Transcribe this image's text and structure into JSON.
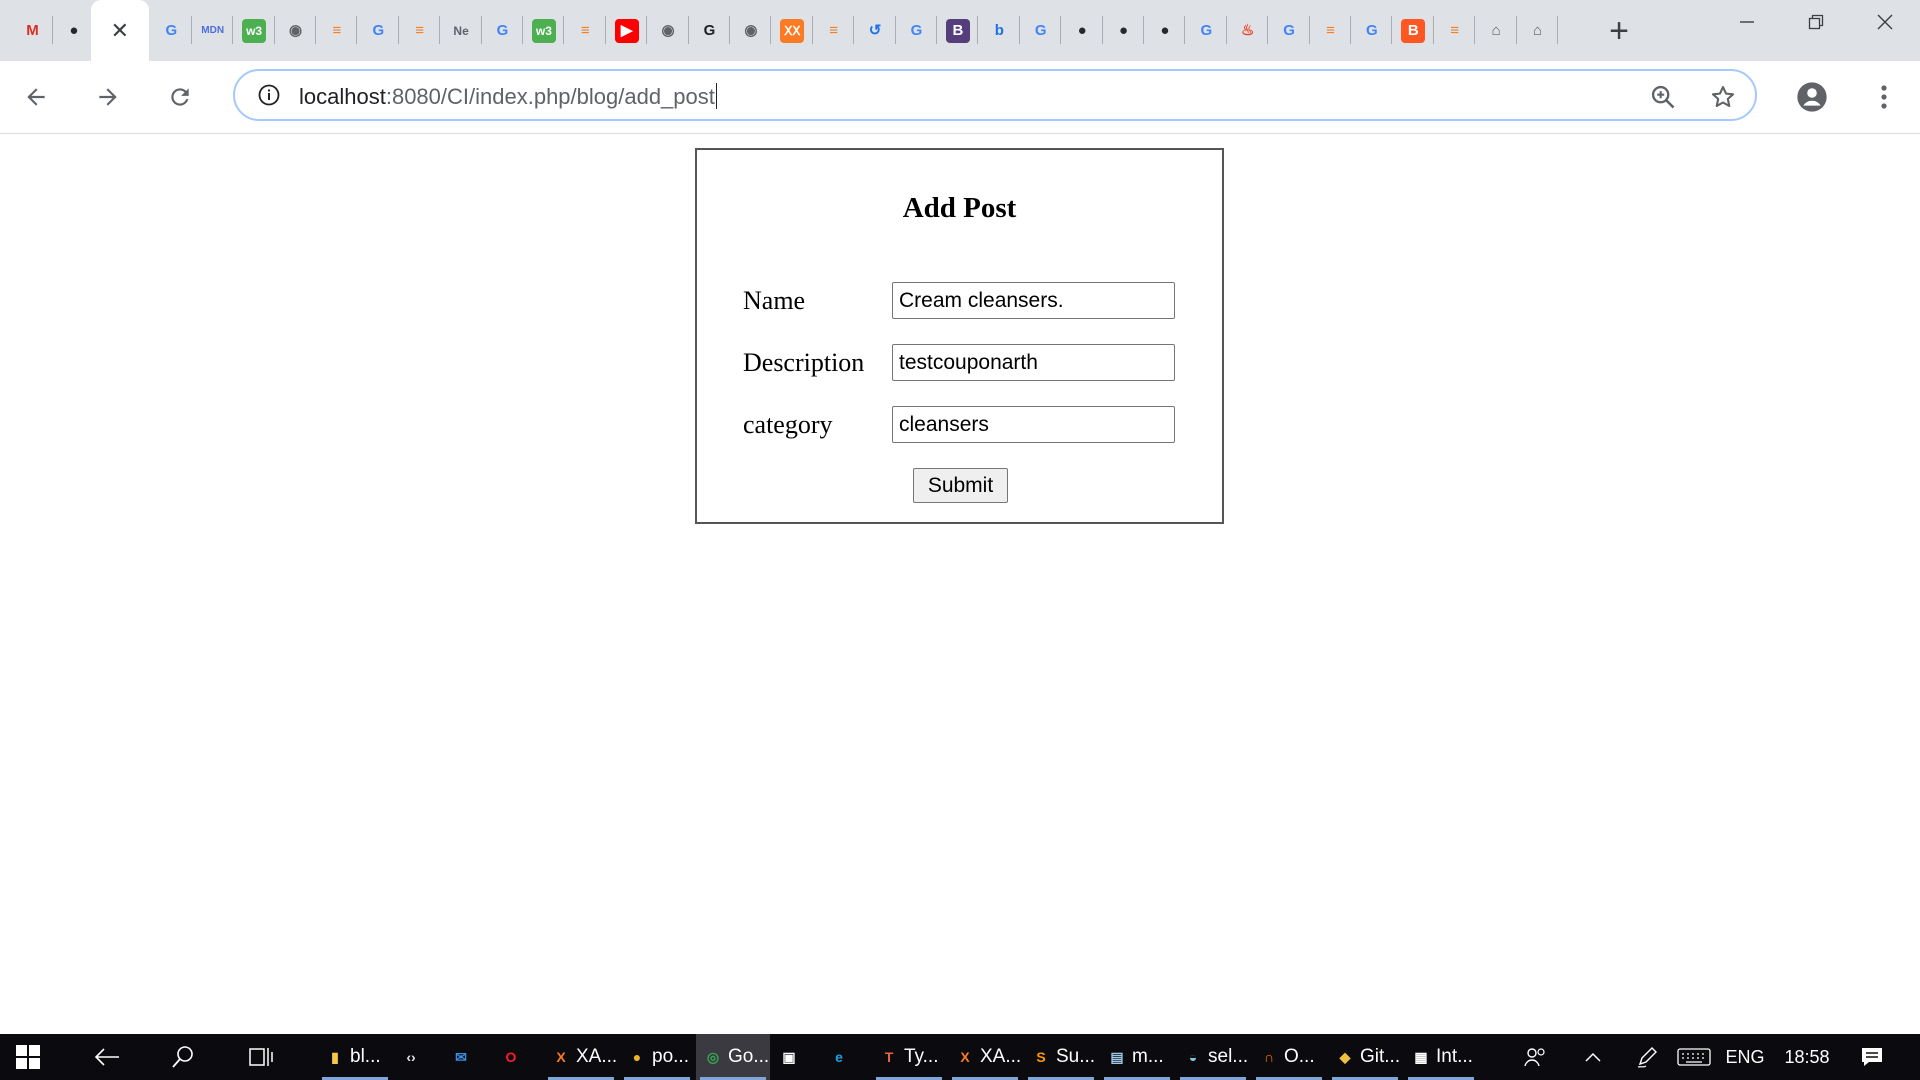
{
  "browser": {
    "tabs": [
      {
        "icon": "gmail-icon",
        "glyph": "M",
        "color": "#d93025",
        "bg": "transparent"
      },
      {
        "icon": "github-icon",
        "glyph": "●",
        "color": "#24292e",
        "bg": "transparent"
      },
      {
        "icon": "close-tab-icon",
        "glyph": "✕",
        "color": "#3c4043",
        "bg": "transparent",
        "active": true
      },
      {
        "icon": "google-icon",
        "glyph": "G",
        "color": "#4285f4",
        "bg": "transparent"
      },
      {
        "icon": "mdn-icon",
        "glyph": "MDN",
        "color": "#4a6ee0",
        "bg": "transparent"
      },
      {
        "icon": "w3schools-icon",
        "glyph": "w3",
        "color": "#ffffff",
        "bg": "#4caf50"
      },
      {
        "icon": "globe-icon",
        "glyph": "◉",
        "color": "#5f6368",
        "bg": "transparent"
      },
      {
        "icon": "stackoverflow-icon",
        "glyph": "≡",
        "color": "#f48024",
        "bg": "transparent"
      },
      {
        "icon": "google-icon",
        "glyph": "G",
        "color": "#4285f4",
        "bg": "transparent"
      },
      {
        "icon": "stackoverflow-icon",
        "glyph": "≡",
        "color": "#f48024",
        "bg": "transparent"
      },
      {
        "icon": "ne-icon",
        "glyph": "Ne",
        "color": "#5f6368",
        "bg": "transparent"
      },
      {
        "icon": "google-icon",
        "glyph": "G",
        "color": "#4285f4",
        "bg": "transparent"
      },
      {
        "icon": "w3schools-icon",
        "glyph": "w3",
        "color": "#ffffff",
        "bg": "#4caf50"
      },
      {
        "icon": "stackoverflow-icon",
        "glyph": "≡",
        "color": "#f48024",
        "bg": "transparent"
      },
      {
        "icon": "youtube-icon",
        "glyph": "▶",
        "color": "#ffffff",
        "bg": "#ff0000"
      },
      {
        "icon": "globe-icon",
        "glyph": "◉",
        "color": "#5f6368",
        "bg": "transparent"
      },
      {
        "icon": "grammarly-icon",
        "glyph": "G",
        "color": "#202124",
        "bg": "transparent"
      },
      {
        "icon": "globe-icon",
        "glyph": "◉",
        "color": "#5f6368",
        "bg": "transparent"
      },
      {
        "icon": "xampp-icon",
        "glyph": "ⅩⅩ",
        "color": "#ffffff",
        "bg": "#fb7a24"
      },
      {
        "icon": "stackoverflow-icon",
        "glyph": "≡",
        "color": "#f48024",
        "bg": "transparent"
      },
      {
        "icon": "history-icon",
        "glyph": "↺",
        "color": "#1a73e8",
        "bg": "transparent"
      },
      {
        "icon": "google-icon",
        "glyph": "G",
        "color": "#4285f4",
        "bg": "transparent"
      },
      {
        "icon": "bootstrap-icon",
        "glyph": "B",
        "color": "#ffffff",
        "bg": "#563d7c"
      },
      {
        "icon": "bing-icon",
        "glyph": "b",
        "color": "#1a73e8",
        "bg": "transparent"
      },
      {
        "icon": "google-icon",
        "glyph": "G",
        "color": "#4285f4",
        "bg": "transparent"
      },
      {
        "icon": "github-icon",
        "glyph": "●",
        "color": "#24292e",
        "bg": "transparent"
      },
      {
        "icon": "github-icon",
        "glyph": "●",
        "color": "#24292e",
        "bg": "transparent"
      },
      {
        "icon": "github-icon",
        "glyph": "●",
        "color": "#24292e",
        "bg": "transparent"
      },
      {
        "icon": "google-icon",
        "glyph": "G",
        "color": "#4285f4",
        "bg": "transparent"
      },
      {
        "icon": "codeigniter-icon",
        "glyph": "♨",
        "color": "#ee4323",
        "bg": "transparent"
      },
      {
        "icon": "google-icon",
        "glyph": "G",
        "color": "#4285f4",
        "bg": "transparent"
      },
      {
        "icon": "stackoverflow-icon",
        "glyph": "≡",
        "color": "#f48024",
        "bg": "transparent"
      },
      {
        "icon": "google-icon",
        "glyph": "G",
        "color": "#4285f4",
        "bg": "transparent"
      },
      {
        "icon": "blogger-icon",
        "glyph": "B",
        "color": "#ffffff",
        "bg": "#ff5722"
      },
      {
        "icon": "stackoverflow-icon",
        "glyph": "≡",
        "color": "#f48024",
        "bg": "transparent"
      },
      {
        "icon": "home-icon",
        "glyph": "⌂",
        "color": "#5f6368",
        "bg": "transparent"
      },
      {
        "icon": "home-icon",
        "glyph": "⌂",
        "color": "#5f6368",
        "bg": "transparent"
      }
    ],
    "new_tab_label": "+",
    "url_host": "localhost",
    "url_path": ":8080/CI/index.php/blog/add_post"
  },
  "form": {
    "title": "Add Post",
    "name_label": "Name",
    "name_value": "Cream cleansers.",
    "description_label": "Description",
    "description_value": "testcouponarth",
    "category_label": "category",
    "category_value": "cleansers",
    "submit_label": "Submit"
  },
  "taskbar": {
    "apps": [
      {
        "icon": "file-explorer-icon",
        "label": "bl...",
        "color": "#f7c948",
        "glyph": "▮"
      },
      {
        "icon": "vscode-icon",
        "label": "",
        "color": "#e8e8e8",
        "glyph": "‹›"
      },
      {
        "icon": "mail-icon",
        "label": "",
        "color": "#3b8de0",
        "glyph": "✉"
      },
      {
        "icon": "opera-icon",
        "label": "",
        "color": "#ff1b2d",
        "glyph": "O"
      },
      {
        "icon": "xampp-icon",
        "label": "XA...",
        "color": "#fb7a24",
        "glyph": "X"
      },
      {
        "icon": "postman-icon",
        "label": "po...",
        "color": "#f0b429",
        "glyph": "●"
      },
      {
        "icon": "chrome-icon",
        "label": "Go...",
        "color": "#34a853",
        "glyph": "◎",
        "active": true
      },
      {
        "icon": "store-icon",
        "label": "",
        "color": "#ffffff",
        "glyph": "▣"
      },
      {
        "icon": "edge-icon",
        "label": "",
        "color": "#1fa0e3",
        "glyph": "e"
      },
      {
        "icon": "typora-icon",
        "label": "Ty...",
        "color": "#e8643c",
        "glyph": "T"
      },
      {
        "icon": "xampp-icon",
        "label": "XA...",
        "color": "#fb7a24",
        "glyph": "X"
      },
      {
        "icon": "sublime-icon",
        "label": "Su...",
        "color": "#ff9800",
        "glyph": "S"
      },
      {
        "icon": "notepad-icon",
        "label": "m...",
        "color": "#9ec7e8",
        "glyph": "▤"
      },
      {
        "icon": "selenium-icon",
        "label": "sel...",
        "color": "#7ec8e3",
        "glyph": "◒"
      },
      {
        "icon": "o-app-icon",
        "label": "O...",
        "color": "#ff6f00",
        "glyph": "∩"
      },
      {
        "icon": "git-icon",
        "label": "Git...",
        "color": "#f0c040",
        "glyph": "◆"
      },
      {
        "icon": "intellij-icon",
        "label": "Int...",
        "color": "#ffffff",
        "glyph": "▦"
      }
    ],
    "language": "ENG",
    "time": "18:58"
  }
}
